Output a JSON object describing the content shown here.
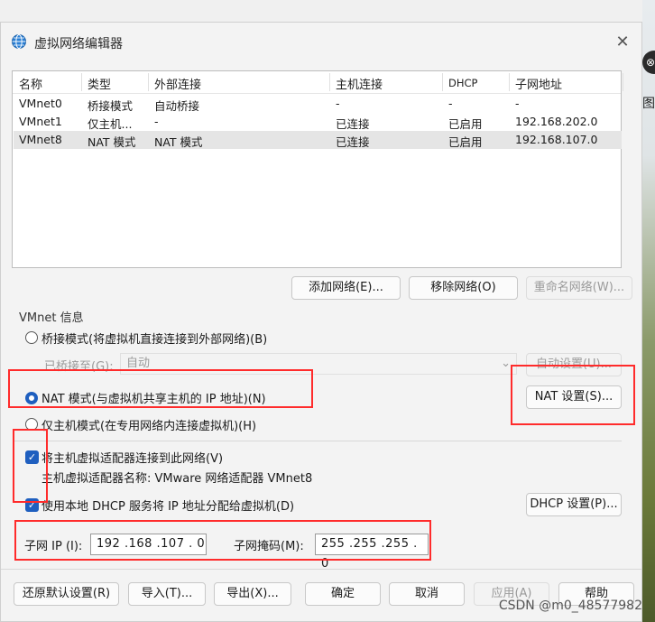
{
  "title": "虚拟网络编辑器",
  "icons": {
    "app": "network-globe-icon",
    "close": "close-icon"
  },
  "background": {
    "round_label": "⊗",
    "side_char": "图"
  },
  "table": {
    "headers": [
      "名称",
      "类型",
      "外部连接",
      "主机连接",
      "DHCP",
      "子网地址"
    ],
    "rows": [
      [
        "VMnet0",
        "桥接模式",
        "自动桥接",
        "-",
        "-",
        "-"
      ],
      [
        "VMnet1",
        "仅主机...",
        "-",
        "已连接",
        "已启用",
        "192.168.202.0"
      ],
      [
        "VMnet8",
        "NAT 模式",
        "NAT 模式",
        "已连接",
        "已启用",
        "192.168.107.0"
      ]
    ]
  },
  "list_buttons": {
    "add": "添加网络(E)...",
    "remove": "移除网络(O)",
    "rename": "重命名网络(W)..."
  },
  "info": {
    "group_label": "VMnet 信息",
    "bridge_label": "桥接模式(将虚拟机直接连接到外部网络)(B)",
    "bridged_to_label": "已桥接至(G):",
    "bridged_to_value": "自动",
    "auto_settings": "自动设置(U)...",
    "nat_label": "NAT 模式(与虚拟机共享主机的 IP 地址)(N)",
    "nat_settings": "NAT 设置(S)...",
    "hostonly_label": "仅主机模式(在专用网络内连接虚拟机)(H)",
    "connect_adapter_label": "将主机虚拟适配器连接到此网络(V)",
    "adapter_name_label": "主机虚拟适配器名称: VMware 网络适配器 VMnet8",
    "dhcp_label": "使用本地 DHCP 服务将 IP 地址分配给虚拟机(D)",
    "dhcp_settings": "DHCP 设置(P)...",
    "subnet_ip_label": "子网 IP (I):",
    "subnet_ip_value": "192 .168 .107 . 0",
    "mask_label": "子网掩码(M):",
    "mask_value": "255 .255 .255 . 0"
  },
  "footer": {
    "restore": "还原默认设置(R)",
    "import": "导入(T)...",
    "export": "导出(X)...",
    "ok": "确定",
    "cancel": "取消",
    "apply": "应用(A)",
    "help": "帮助"
  },
  "watermark": "CSDN @m0_48577982",
  "colors": {
    "accent": "#1f5fbf",
    "highlight": "#ff2b2b",
    "selected_row": "#e5e5e5"
  }
}
